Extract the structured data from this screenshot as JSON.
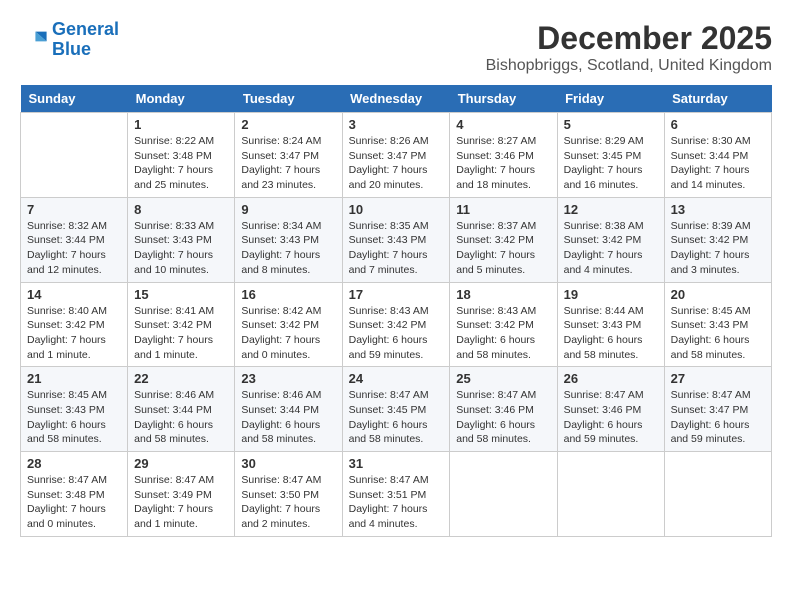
{
  "header": {
    "logo_line1": "General",
    "logo_line2": "Blue",
    "month_title": "December 2025",
    "location": "Bishopbriggs, Scotland, United Kingdom"
  },
  "days_of_week": [
    "Sunday",
    "Monday",
    "Tuesday",
    "Wednesday",
    "Thursday",
    "Friday",
    "Saturday"
  ],
  "weeks": [
    [
      {
        "date": "",
        "info": ""
      },
      {
        "date": "1",
        "info": "Sunrise: 8:22 AM\nSunset: 3:48 PM\nDaylight: 7 hours\nand 25 minutes."
      },
      {
        "date": "2",
        "info": "Sunrise: 8:24 AM\nSunset: 3:47 PM\nDaylight: 7 hours\nand 23 minutes."
      },
      {
        "date": "3",
        "info": "Sunrise: 8:26 AM\nSunset: 3:47 PM\nDaylight: 7 hours\nand 20 minutes."
      },
      {
        "date": "4",
        "info": "Sunrise: 8:27 AM\nSunset: 3:46 PM\nDaylight: 7 hours\nand 18 minutes."
      },
      {
        "date": "5",
        "info": "Sunrise: 8:29 AM\nSunset: 3:45 PM\nDaylight: 7 hours\nand 16 minutes."
      },
      {
        "date": "6",
        "info": "Sunrise: 8:30 AM\nSunset: 3:44 PM\nDaylight: 7 hours\nand 14 minutes."
      }
    ],
    [
      {
        "date": "7",
        "info": "Sunrise: 8:32 AM\nSunset: 3:44 PM\nDaylight: 7 hours\nand 12 minutes."
      },
      {
        "date": "8",
        "info": "Sunrise: 8:33 AM\nSunset: 3:43 PM\nDaylight: 7 hours\nand 10 minutes."
      },
      {
        "date": "9",
        "info": "Sunrise: 8:34 AM\nSunset: 3:43 PM\nDaylight: 7 hours\nand 8 minutes."
      },
      {
        "date": "10",
        "info": "Sunrise: 8:35 AM\nSunset: 3:43 PM\nDaylight: 7 hours\nand 7 minutes."
      },
      {
        "date": "11",
        "info": "Sunrise: 8:37 AM\nSunset: 3:42 PM\nDaylight: 7 hours\nand 5 minutes."
      },
      {
        "date": "12",
        "info": "Sunrise: 8:38 AM\nSunset: 3:42 PM\nDaylight: 7 hours\nand 4 minutes."
      },
      {
        "date": "13",
        "info": "Sunrise: 8:39 AM\nSunset: 3:42 PM\nDaylight: 7 hours\nand 3 minutes."
      }
    ],
    [
      {
        "date": "14",
        "info": "Sunrise: 8:40 AM\nSunset: 3:42 PM\nDaylight: 7 hours\nand 1 minute."
      },
      {
        "date": "15",
        "info": "Sunrise: 8:41 AM\nSunset: 3:42 PM\nDaylight: 7 hours\nand 1 minute."
      },
      {
        "date": "16",
        "info": "Sunrise: 8:42 AM\nSunset: 3:42 PM\nDaylight: 7 hours\nand 0 minutes."
      },
      {
        "date": "17",
        "info": "Sunrise: 8:43 AM\nSunset: 3:42 PM\nDaylight: 6 hours\nand 59 minutes."
      },
      {
        "date": "18",
        "info": "Sunrise: 8:43 AM\nSunset: 3:42 PM\nDaylight: 6 hours\nand 58 minutes."
      },
      {
        "date": "19",
        "info": "Sunrise: 8:44 AM\nSunset: 3:43 PM\nDaylight: 6 hours\nand 58 minutes."
      },
      {
        "date": "20",
        "info": "Sunrise: 8:45 AM\nSunset: 3:43 PM\nDaylight: 6 hours\nand 58 minutes."
      }
    ],
    [
      {
        "date": "21",
        "info": "Sunrise: 8:45 AM\nSunset: 3:43 PM\nDaylight: 6 hours\nand 58 minutes."
      },
      {
        "date": "22",
        "info": "Sunrise: 8:46 AM\nSunset: 3:44 PM\nDaylight: 6 hours\nand 58 minutes."
      },
      {
        "date": "23",
        "info": "Sunrise: 8:46 AM\nSunset: 3:44 PM\nDaylight: 6 hours\nand 58 minutes."
      },
      {
        "date": "24",
        "info": "Sunrise: 8:47 AM\nSunset: 3:45 PM\nDaylight: 6 hours\nand 58 minutes."
      },
      {
        "date": "25",
        "info": "Sunrise: 8:47 AM\nSunset: 3:46 PM\nDaylight: 6 hours\nand 58 minutes."
      },
      {
        "date": "26",
        "info": "Sunrise: 8:47 AM\nSunset: 3:46 PM\nDaylight: 6 hours\nand 59 minutes."
      },
      {
        "date": "27",
        "info": "Sunrise: 8:47 AM\nSunset: 3:47 PM\nDaylight: 6 hours\nand 59 minutes."
      }
    ],
    [
      {
        "date": "28",
        "info": "Sunrise: 8:47 AM\nSunset: 3:48 PM\nDaylight: 7 hours\nand 0 minutes."
      },
      {
        "date": "29",
        "info": "Sunrise: 8:47 AM\nSunset: 3:49 PM\nDaylight: 7 hours\nand 1 minute."
      },
      {
        "date": "30",
        "info": "Sunrise: 8:47 AM\nSunset: 3:50 PM\nDaylight: 7 hours\nand 2 minutes."
      },
      {
        "date": "31",
        "info": "Sunrise: 8:47 AM\nSunset: 3:51 PM\nDaylight: 7 hours\nand 4 minutes."
      },
      {
        "date": "",
        "info": ""
      },
      {
        "date": "",
        "info": ""
      },
      {
        "date": "",
        "info": ""
      }
    ]
  ]
}
